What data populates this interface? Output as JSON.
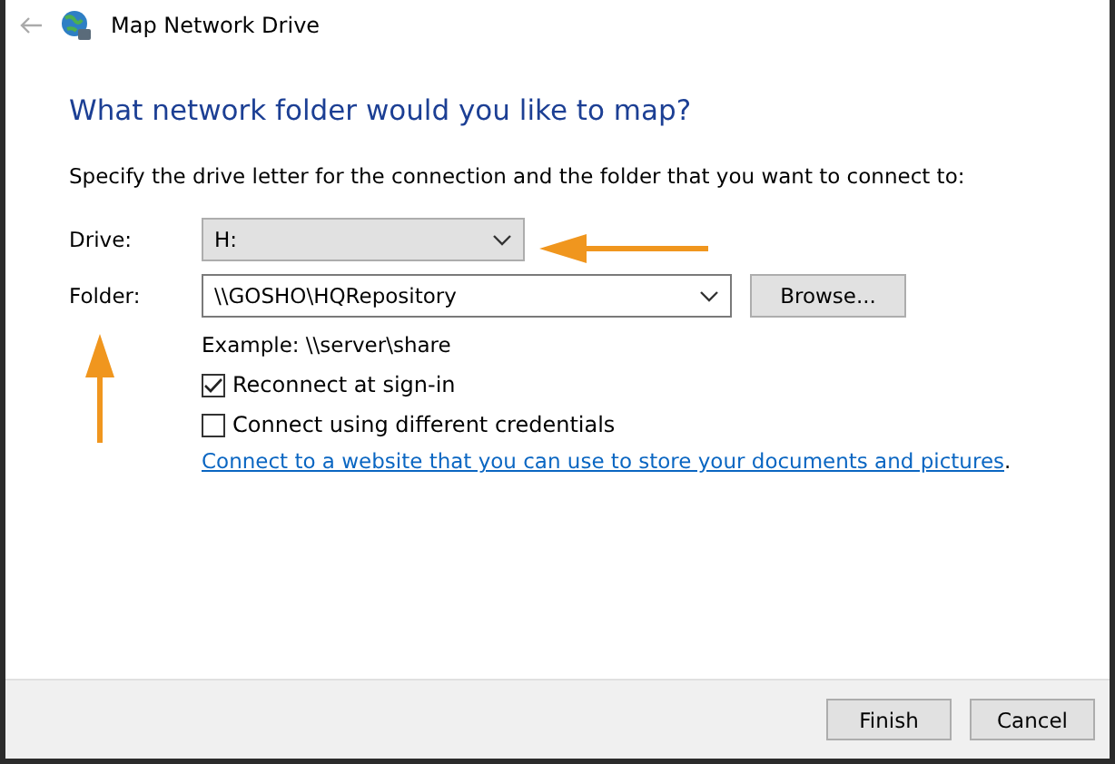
{
  "window": {
    "title": "Map Network Drive"
  },
  "heading": "What network folder would you like to map?",
  "instruction": "Specify the drive letter for the connection and the folder that you want to connect to:",
  "drive": {
    "label": "Drive:",
    "value": "H:"
  },
  "folder": {
    "label": "Folder:",
    "value": "\\\\GOSHO\\HQRepository",
    "browse": "Browse..."
  },
  "example": "Example: \\\\server\\share",
  "options": [
    {
      "label": "Reconnect at sign-in",
      "checked": true
    },
    {
      "label": "Connect using different credentials",
      "checked": false
    }
  ],
  "link": {
    "text": "Connect to a website that you can use to store your documents and pictures",
    "trailing": "."
  },
  "buttons": [
    "Finish",
    "Cancel"
  ]
}
